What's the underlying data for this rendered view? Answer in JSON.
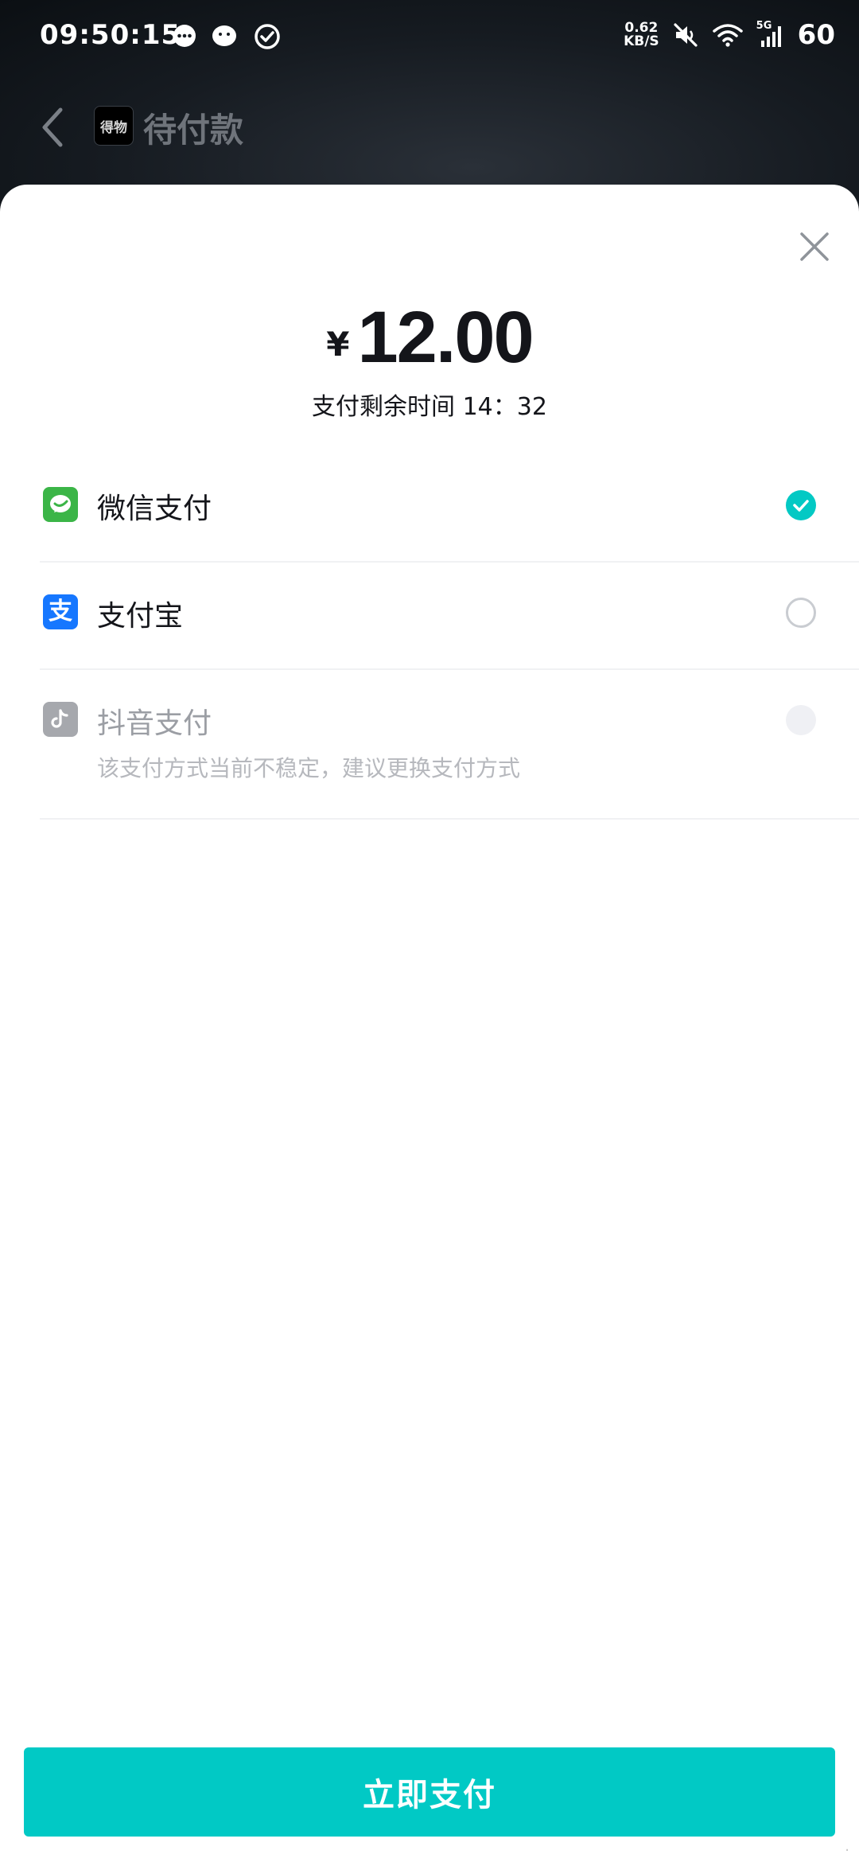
{
  "status_bar": {
    "time": "09:50:15",
    "net_speed_value": "0.62",
    "net_speed_unit": "KB/S",
    "network_type": "5G",
    "battery": "60",
    "notification_icons": [
      "chat-bubble-icon",
      "wechat-icon",
      "check-circle-icon"
    ]
  },
  "nav": {
    "logo_text": "得物",
    "title": "待付款"
  },
  "sheet": {
    "currency_symbol": "¥",
    "amount": "12.00",
    "countdown_label": "支付剩余时间 14：32",
    "pay_button_label": "立即支付"
  },
  "payment_options": [
    {
      "label": "微信支付",
      "icon": "wechat-pay-icon",
      "state": "selected",
      "icon_color": "#3bb547"
    },
    {
      "label": "支付宝",
      "icon": "alipay-icon",
      "state": "unselected",
      "icon_color": "#1677ff"
    },
    {
      "label": "抖音支付",
      "icon": "douyin-pay-icon",
      "state": "disabled",
      "note": "该支付方式当前不稳定，建议更换支付方式",
      "icon_color": "#a6a8ad"
    }
  ],
  "colors": {
    "accent": "#01c9c5",
    "text_primary": "#14151a",
    "text_disabled": "#9b9ea4"
  }
}
